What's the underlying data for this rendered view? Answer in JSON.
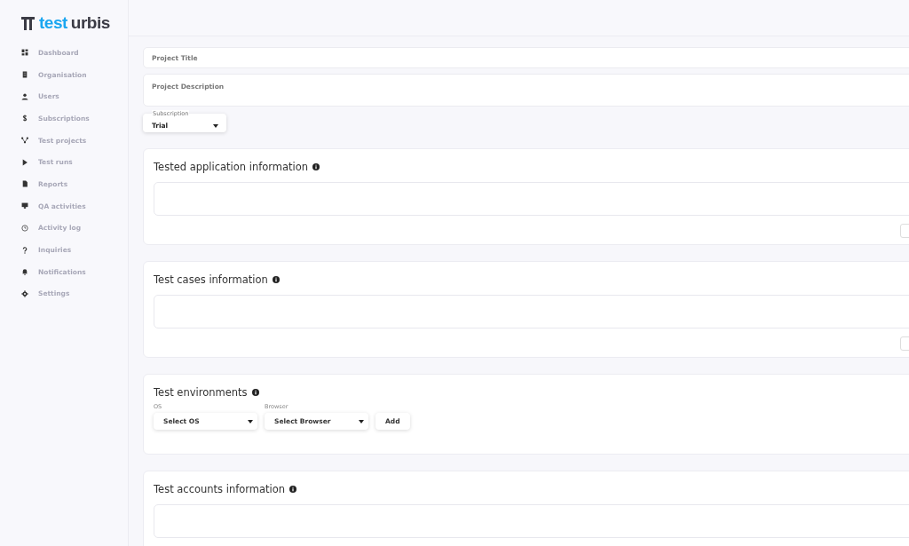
{
  "logo": {
    "prefix": "test",
    "suffix": "urbis"
  },
  "sidebar": {
    "items": [
      {
        "label": "Dashboard"
      },
      {
        "label": "Organisation"
      },
      {
        "label": "Users"
      },
      {
        "label": "Subscriptions"
      },
      {
        "label": "Test projects"
      },
      {
        "label": "Test runs"
      },
      {
        "label": "Reports"
      },
      {
        "label": "QA activities"
      },
      {
        "label": "Activity log"
      },
      {
        "label": "Inquiries"
      },
      {
        "label": "Notifications"
      },
      {
        "label": "Settings"
      }
    ]
  },
  "form": {
    "title_placeholder": "Project Title",
    "description_placeholder": "Project Description",
    "subscription": {
      "label": "Subscription",
      "value": "Trial"
    }
  },
  "sections": [
    {
      "kind": "textarea",
      "title": "Tested application information"
    },
    {
      "kind": "textarea",
      "title": "Test cases information"
    },
    {
      "kind": "environments",
      "title": "Test environments",
      "os": {
        "label": "OS",
        "value": "Select OS"
      },
      "browser": {
        "label": "Browser",
        "value": "Select Browser"
      },
      "add": "Add"
    },
    {
      "kind": "textarea",
      "title": "Test accounts information"
    }
  ]
}
